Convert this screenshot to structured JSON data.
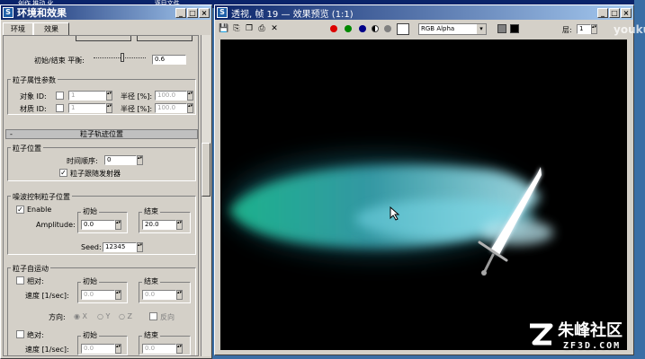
{
  "background_window": {
    "title_fragment": "创作 推动 化",
    "title_fragment2": "逐目文件"
  },
  "env_window": {
    "title": "环境和效果",
    "tabs": [
      "环境",
      "效果"
    ],
    "start_end_label": "初始/结束 平衡:",
    "start_end_value": "0.6",
    "particle_props": {
      "title": "粒子属性参数",
      "object_id_label": "对象 ID:",
      "object_id_value": "1",
      "material_id_label": "材质 ID:",
      "material_id_value": "1",
      "radius_label": "半径 [%]:",
      "radius_value1": "100.0",
      "radius_value2": "100.0"
    },
    "trajectory_bar": "粒子轨迹位置",
    "particle_position": {
      "title": "粒子位置",
      "time_order_label": "时间顺序:",
      "time_order_value": "0",
      "follow_emitter_label": "粒子跟随发射器"
    },
    "noise": {
      "title": "噪波控制粒子位置",
      "enable_label": "Enable",
      "start_title": "初始",
      "end_title": "结束",
      "amplitude_label": "Amplitude:",
      "amplitude_start": "0.0",
      "amplitude_end": "20.0",
      "seed_label": "Seed:",
      "seed_value": "12345"
    },
    "self_motion": {
      "title": "粒子自运动",
      "relative_label": "相对:",
      "start_title": "初始",
      "end_title": "结束",
      "speed_label": "速度 [1/sec]:",
      "speed_start": "0.0",
      "speed_end": "0.0",
      "direction_label": "方向:",
      "dir_x": "X",
      "dir_y": "Y",
      "dir_z": "Z",
      "reverse_label": "反向",
      "absolute_label": "绝对:",
      "abs_speed_start": "0.0",
      "abs_speed_end": "0.0"
    },
    "minus_sign": "-"
  },
  "preview_window": {
    "title": "透视, 帧 19 — 效果预览 (1:1)",
    "channel_select": "RGB Alpha",
    "layer_label": "层:",
    "layer_value": "1"
  },
  "watermarks": {
    "youku": "youku",
    "site_logo": "朱峰社区",
    "site_url": "ZF3D.COM"
  },
  "colors": {
    "desktop": "#3a6ea5",
    "titlebar_active": "#0a246a",
    "panel": "#d4d0c8",
    "render_bg": "#000000"
  }
}
